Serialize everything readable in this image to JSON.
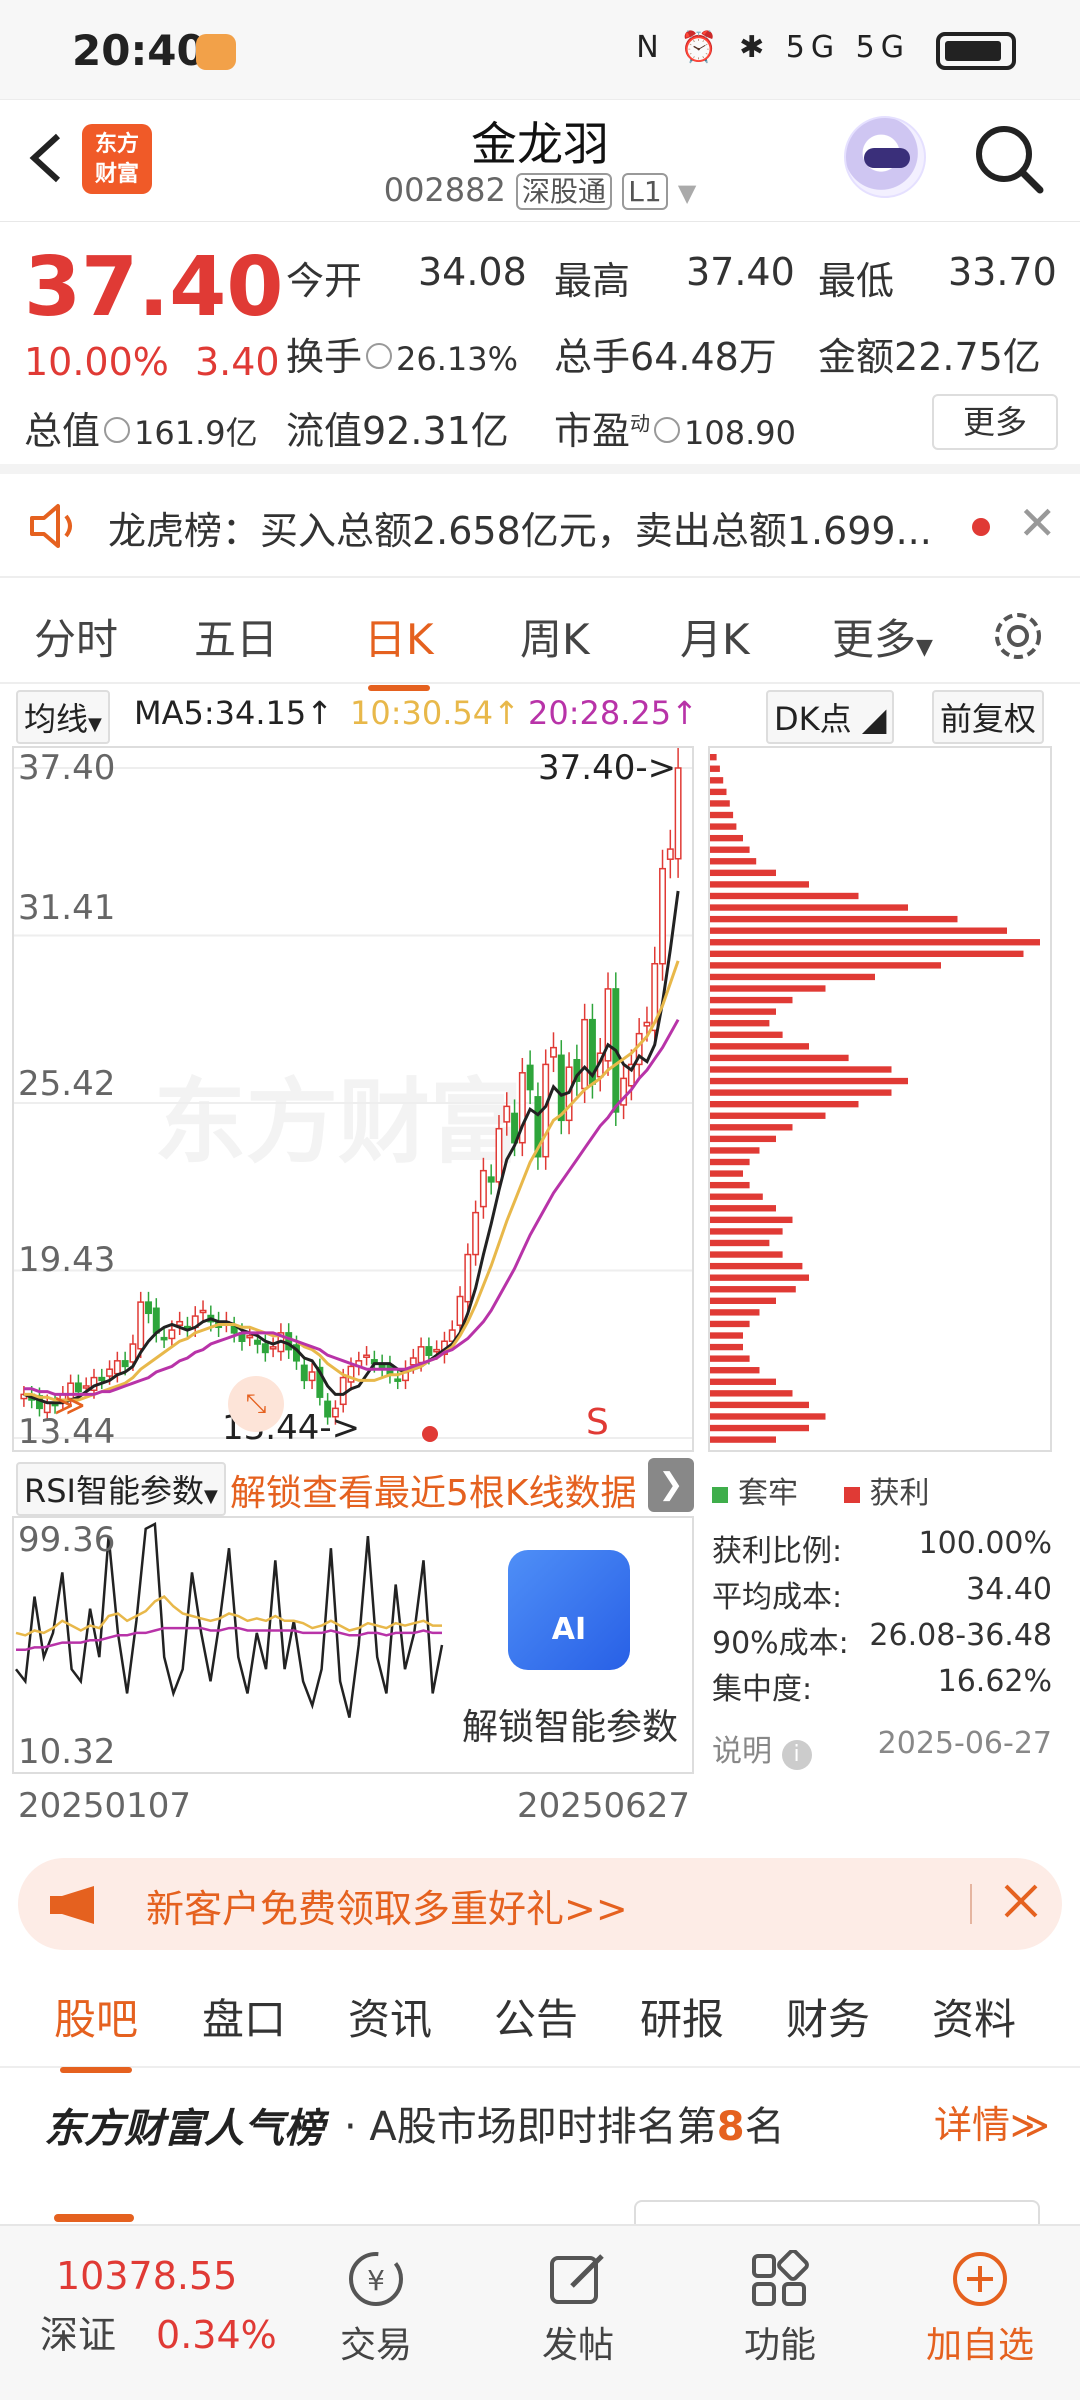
{
  "status_bar": {
    "time": "20:40",
    "icons": "N ⏰ ✱ 5G 5G"
  },
  "header": {
    "logo_text": "东方财富",
    "title": "金龙羽",
    "code": "002882",
    "market_tag": "深股通",
    "level_tag": "L1"
  },
  "quote": {
    "price": "37.40",
    "change_pct": "10.00%",
    "change": "3.40",
    "open_label": "今开",
    "open": "34.08",
    "high_label": "最高",
    "high": "37.40",
    "low_label": "最低",
    "low": "33.70",
    "turnover_label": "换手",
    "turnover": "26.13%",
    "volume_label": "总手",
    "volume": "64.48万",
    "amount_label": "金额",
    "amount": "22.75亿",
    "mktcap_label": "总值",
    "mktcap": "161.9亿",
    "float_label": "流值",
    "float": "92.31亿",
    "pe_label": "市盈",
    "pe_sup": "动",
    "pe": "108.90",
    "more_label": "更多"
  },
  "notice": {
    "text": "龙虎榜：买入总额2.658亿元，卖出总额1.699..."
  },
  "kline_tabs": {
    "items": [
      "分时",
      "五日",
      "日K",
      "周K",
      "月K",
      "更多"
    ],
    "active": "日K"
  },
  "ma_bar": {
    "selector": "均线",
    "ma5": "MA5:34.15↑",
    "ma10": "10:30.54↑",
    "ma20": "20:28.25↑",
    "dk": "DK点",
    "adjust": "前复权"
  },
  "chart": {
    "y_labels": [
      "37.40",
      "31.41",
      "25.42",
      "19.43",
      "13.44"
    ],
    "last_price_marker": "37.40->",
    "low_marker": "13.44->",
    "signal": "S",
    "watermark": "东方财富",
    "colors": {
      "up": "#e03a35",
      "down": "#2ea53b",
      "ma5": "#222222",
      "ma10": "#e8b84a",
      "ma20": "#b833a8"
    }
  },
  "chart_data": {
    "type": "candlestick",
    "title": "",
    "ylim": [
      13.44,
      37.4
    ],
    "x_range": [
      "20250107",
      "20250627"
    ],
    "close": [
      15.0,
      14.8,
      14.5,
      14.7,
      14.6,
      15.0,
      15.4,
      15.1,
      15.3,
      15.6,
      15.5,
      15.9,
      16.2,
      16.0,
      16.8,
      18.3,
      17.9,
      17.2,
      17.0,
      17.3,
      17.6,
      17.4,
      17.8,
      18.0,
      17.6,
      17.4,
      17.6,
      17.2,
      16.9,
      17.1,
      16.8,
      16.5,
      16.7,
      17.2,
      16.6,
      16.2,
      15.5,
      15.8,
      14.9,
      14.2,
      14.5,
      15.6,
      16.0,
      16.2,
      16.4,
      16.1,
      15.9,
      15.7,
      15.5,
      15.9,
      16.3,
      16.7,
      16.4,
      16.6,
      16.9,
      17.3,
      18.5,
      20.0,
      21.5,
      23.0,
      22.6,
      24.5,
      25.3,
      24.0,
      26.5,
      25.9,
      23.5,
      26.8,
      27.4,
      24.8,
      26.7,
      26.2,
      28.4,
      26.1,
      27.2,
      29.5,
      25.1,
      26.3,
      26.8,
      27.9,
      28.3,
      30.4,
      33.8,
      34.5,
      37.4
    ],
    "ma5": [
      15.0,
      14.9,
      14.8,
      14.7,
      14.7,
      14.7,
      14.8,
      14.9,
      15.1,
      15.3,
      15.4,
      15.5,
      15.7,
      15.8,
      16.0,
      16.5,
      16.9,
      17.2,
      17.4,
      17.5,
      17.4,
      17.3,
      17.4,
      17.6,
      17.7,
      17.6,
      17.6,
      17.5,
      17.3,
      17.2,
      17.1,
      16.9,
      16.8,
      16.9,
      16.8,
      16.6,
      16.3,
      16.2,
      15.8,
      15.3,
      15.0,
      15.0,
      15.2,
      15.3,
      15.7,
      16.1,
      16.1,
      16.1,
      15.9,
      15.8,
      15.9,
      16.0,
      16.2,
      16.4,
      16.6,
      16.8,
      17.2,
      17.9,
      18.8,
      20.0,
      21.1,
      22.3,
      23.4,
      23.9,
      24.6,
      25.2,
      25.0,
      25.3,
      26.0,
      25.7,
      25.8,
      26.4,
      26.7,
      26.4,
      26.9,
      27.5,
      27.3,
      26.8,
      26.6,
      27.1,
      26.9,
      27.5,
      29.0,
      30.9,
      33.0
    ],
    "ma10": [
      15.0,
      15.0,
      14.9,
      14.9,
      14.8,
      14.8,
      14.8,
      14.8,
      14.9,
      15.0,
      15.1,
      15.2,
      15.3,
      15.4,
      15.6,
      15.9,
      16.1,
      16.3,
      16.5,
      16.7,
      16.9,
      17.0,
      17.2,
      17.3,
      17.4,
      17.5,
      17.5,
      17.5,
      17.4,
      17.4,
      17.3,
      17.2,
      17.1,
      17.1,
      17.0,
      16.9,
      16.7,
      16.6,
      16.4,
      16.1,
      15.9,
      15.7,
      15.6,
      15.5,
      15.5,
      15.5,
      15.6,
      15.7,
      15.7,
      15.8,
      15.9,
      16.0,
      16.2,
      16.3,
      16.5,
      16.7,
      17.1,
      17.6,
      18.2,
      18.9,
      19.6,
      20.4,
      21.2,
      21.9,
      22.6,
      23.3,
      23.8,
      24.3,
      24.8,
      25.0,
      25.3,
      25.6,
      25.9,
      26.1,
      26.3,
      26.6,
      26.8,
      27.0,
      27.2,
      27.5,
      27.8,
      28.3,
      28.9,
      29.7,
      30.5
    ],
    "ma20": [
      15.2,
      15.2,
      15.1,
      15.1,
      15.0,
      15.0,
      15.0,
      15.0,
      15.0,
      15.0,
      15.1,
      15.1,
      15.2,
      15.3,
      15.4,
      15.5,
      15.6,
      15.8,
      15.9,
      16.0,
      16.2,
      16.3,
      16.5,
      16.6,
      16.8,
      16.9,
      17.0,
      17.1,
      17.2,
      17.2,
      17.2,
      17.2,
      17.2,
      17.1,
      17.0,
      16.9,
      16.8,
      16.7,
      16.6,
      16.4,
      16.3,
      16.2,
      16.1,
      16.0,
      15.9,
      15.9,
      15.9,
      15.9,
      15.9,
      15.9,
      16.0,
      16.1,
      16.2,
      16.3,
      16.5,
      16.6,
      16.8,
      17.0,
      17.3,
      17.6,
      18.0,
      18.5,
      19.0,
      19.5,
      20.1,
      20.7,
      21.2,
      21.7,
      22.2,
      22.6,
      23.0,
      23.4,
      23.8,
      24.2,
      24.6,
      24.9,
      25.3,
      25.6,
      25.9,
      26.3,
      26.6,
      27.0,
      27.4,
      27.9,
      28.4
    ]
  },
  "rsi_bar": {
    "selector": "RSI智能参数",
    "unlock": "解锁查看最近5根K线数据"
  },
  "rsi": {
    "y_top": "99.36",
    "y_bottom": "10.32",
    "ai_badge": "AI",
    "ai_text": "解锁智能参数",
    "rsi1": [
      40,
      35,
      70,
      45,
      55,
      80,
      40,
      35,
      65,
      45,
      95,
      55,
      30,
      60,
      98,
      100,
      45,
      30,
      40,
      80,
      55,
      35,
      60,
      90,
      45,
      30,
      55,
      40,
      85,
      40,
      60,
      35,
      25,
      40,
      90,
      35,
      20,
      50,
      95,
      45,
      30,
      75,
      40,
      55,
      85,
      30,
      50
    ],
    "rsi2": [
      55,
      54,
      56,
      55,
      57,
      60,
      58,
      56,
      58,
      57,
      62,
      63,
      60,
      62,
      64,
      68,
      70,
      66,
      63,
      62,
      61,
      60,
      61,
      63,
      62,
      60,
      61,
      60,
      62,
      60,
      60,
      59,
      57,
      58,
      60,
      58,
      56,
      57,
      59,
      58,
      57,
      59,
      58,
      59,
      60,
      58,
      58
    ],
    "rsi3": [
      48,
      48,
      49,
      49,
      50,
      51,
      51,
      51,
      52,
      52,
      53,
      54,
      54,
      55,
      55,
      56,
      57,
      57,
      57,
      57,
      57,
      56,
      56,
      57,
      57,
      56,
      56,
      56,
      56,
      56,
      56,
      55,
      55,
      55,
      56,
      55,
      54,
      54,
      55,
      55,
      54,
      55,
      55,
      55,
      56,
      55,
      55
    ]
  },
  "dates": {
    "start": "20250107",
    "end": "20250627"
  },
  "distribution": {
    "legend_trapped": "套牢",
    "legend_profit": "获利",
    "rows": [
      {
        "label": "获利比例:",
        "value": "100.00%"
      },
      {
        "label": "平均成本:",
        "value": "34.40"
      },
      {
        "label": "90%成本:",
        "value": "26.08-36.48"
      },
      {
        "label": "集中度:",
        "value": "16.62%"
      }
    ],
    "note_label": "说明",
    "note_date": "2025-06-27",
    "profile": [
      0.02,
      0.03,
      0.04,
      0.05,
      0.06,
      0.07,
      0.08,
      0.1,
      0.12,
      0.14,
      0.2,
      0.3,
      0.45,
      0.6,
      0.75,
      0.9,
      1.0,
      0.95,
      0.7,
      0.5,
      0.35,
      0.25,
      0.2,
      0.18,
      0.22,
      0.3,
      0.42,
      0.55,
      0.6,
      0.55,
      0.45,
      0.35,
      0.25,
      0.2,
      0.15,
      0.12,
      0.1,
      0.12,
      0.16,
      0.2,
      0.25,
      0.22,
      0.18,
      0.22,
      0.28,
      0.3,
      0.26,
      0.2,
      0.15,
      0.12,
      0.1,
      0.1,
      0.12,
      0.15,
      0.2,
      0.25,
      0.3,
      0.35,
      0.3,
      0.2
    ]
  },
  "promo": {
    "text": "新客户免费领取多重好礼>>"
  },
  "section_tabs": {
    "items": [
      "股吧",
      "盘口",
      "资讯",
      "公告",
      "研报",
      "财务",
      "资料"
    ],
    "active": "股吧"
  },
  "popularity": {
    "brand": "东方财富人气榜",
    "prefix": "· A股市场即时排名第",
    "rank": "8",
    "suffix": "名",
    "detail": "详情≫"
  },
  "bottom_nav": {
    "index_value": "10378.55",
    "index_name": "深证",
    "index_change": "0.34%",
    "items": [
      {
        "label": "交易",
        "icon": "yuan-cycle-icon"
      },
      {
        "label": "发帖",
        "icon": "edit-icon"
      },
      {
        "label": "功能",
        "icon": "grid-icon"
      },
      {
        "label": "加自选",
        "icon": "plus-circle-icon"
      }
    ]
  }
}
